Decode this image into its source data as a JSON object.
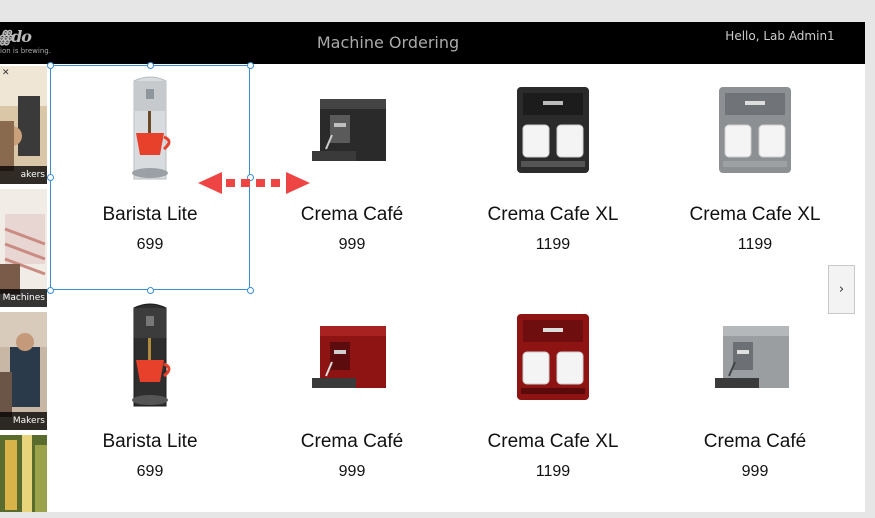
{
  "header": {
    "title": "Machine Ordering",
    "greeting": "Hello, Lab Admin1",
    "logo_mark": "ꙮdo",
    "logo_tagline": "ion is brewing."
  },
  "categories": [
    {
      "label": "akers"
    },
    {
      "label": "Machines"
    },
    {
      "label": "Makers"
    },
    {
      "label": ""
    }
  ],
  "products": [
    {
      "name": "Barista Lite",
      "price": "699",
      "image": "pod-machine-silver-icon"
    },
    {
      "name": "Crema Café",
      "price": "999",
      "image": "espresso-machine-black-icon"
    },
    {
      "name": "Crema Cafe XL",
      "price": "1199",
      "image": "dual-cup-machine-black-icon"
    },
    {
      "name": "Crema Cafe XL",
      "price": "1199",
      "image": "dual-cup-machine-silver-icon"
    },
    {
      "name": "Barista Lite",
      "price": "699",
      "image": "pod-machine-black-icon"
    },
    {
      "name": "Crema Café",
      "price": "999",
      "image": "espresso-machine-red-icon"
    },
    {
      "name": "Crema Cafe XL",
      "price": "1199",
      "image": "dual-cup-machine-red-icon"
    },
    {
      "name": "Crema Café",
      "price": "999",
      "image": "espresso-machine-silver-icon"
    }
  ],
  "navigation": {
    "next_icon": "›"
  },
  "colors": {
    "header_bg": "#000000",
    "selection": "#3b8fd6",
    "resize_arrow": "#ef4444"
  }
}
